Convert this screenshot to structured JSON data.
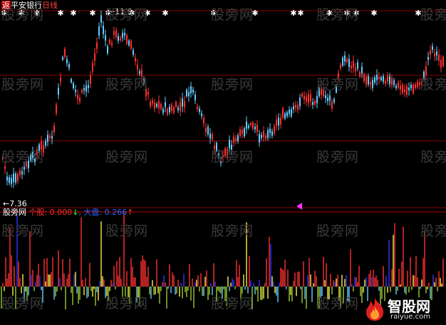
{
  "header": {
    "back_button_label": "返",
    "stock_name": "平安银行",
    "period": "日线"
  },
  "price_pane": {
    "high_marker_label": "←11.9",
    "low_marker_label": "←7.36"
  },
  "indicator": {
    "name": "股旁网",
    "item1_label": "个股",
    "item1_value": "0.000",
    "item1_arrow": "↓",
    "item2_label": "大盘",
    "item2_value": "0.266",
    "item2_arrow": "↑"
  },
  "watermark_text": "股旁网",
  "logo": {
    "name": "智股网",
    "url": "raiyue.com",
    "icon": "flame-icon"
  },
  "colors": {
    "background": "#000000",
    "grid": "#8a0000",
    "up_candle": "#ff3030",
    "down_candle": "#66ccff",
    "volume_green": "#99cc33",
    "volume_yellow": "#ffee44",
    "volume_blue": "#3333ff",
    "text_white": "#ffffff",
    "value_red": "#ff3030",
    "value_blue": "#3366ff",
    "logo_red": "#e02020"
  }
}
